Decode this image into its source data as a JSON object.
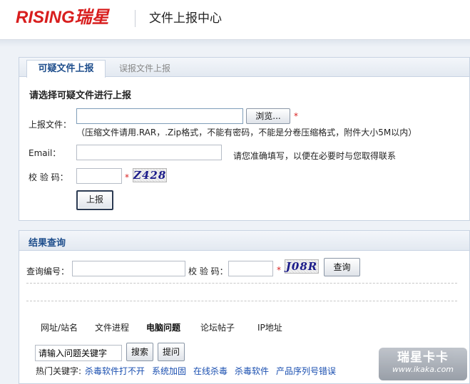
{
  "header": {
    "logo_text": "RISING瑞星",
    "title": "文件上报中心"
  },
  "upload_panel": {
    "tabs": [
      {
        "label": "可疑文件上报",
        "active": true
      },
      {
        "label": "误报文件上报",
        "active": false
      }
    ],
    "section_title": "请选择可疑文件进行上报",
    "file_label": "上报文件：",
    "file_value": "",
    "browse_label": "浏览...",
    "required_mark": "*",
    "file_note": "（压缩文件请用.RAR，.Zip格式，不能有密码，不能是分卷压缩格式，附件大小5M以内）",
    "email_label": "Email：",
    "email_value": "",
    "email_note": "请您准确填写，以便在必要时与您取得联系",
    "code_label": "校 验 码：",
    "code_value": "",
    "captcha_text": "Z428",
    "submit_label": "上报"
  },
  "query_panel": {
    "title": "结果查询",
    "query_no_label": "查询编号：",
    "query_no_value": "",
    "code_label": "校 验 码：",
    "code_value": "",
    "required_mark": "*",
    "captcha_text": "J08R",
    "query_button": "查询",
    "nav": [
      {
        "label": "网址/站名",
        "active": false
      },
      {
        "label": "文件进程",
        "active": false
      },
      {
        "label": "电脑问题",
        "active": true
      },
      {
        "label": "论坛帖子",
        "active": false
      },
      {
        "label": "IP地址",
        "active": false
      }
    ],
    "search_value": "请输入问题关键字",
    "search_button": "搜索",
    "ask_button": "提问",
    "hot_label": "热门关键字:",
    "hot_keywords": [
      "杀毒软件打不开",
      "系统加固",
      "在线杀毒",
      "杀毒软件",
      "产品序列号错误"
    ]
  },
  "watermark": {
    "title": "瑞星卡卡",
    "url": "www.ikaka.com"
  }
}
